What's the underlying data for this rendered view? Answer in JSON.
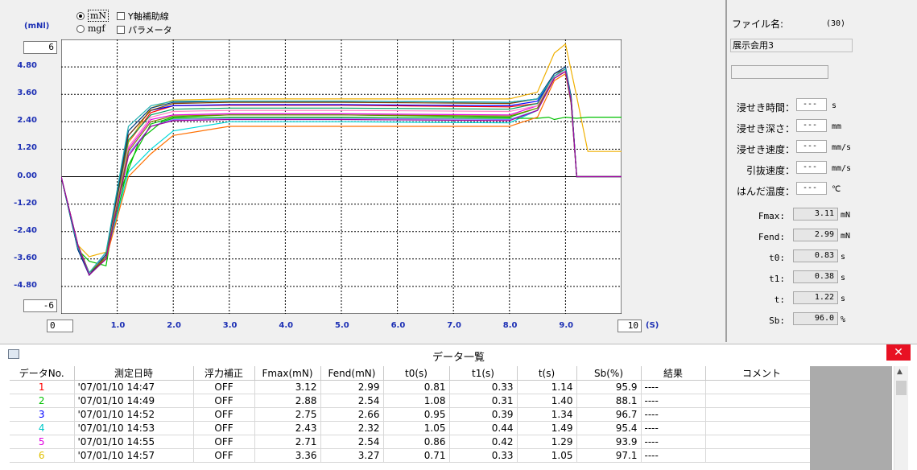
{
  "chart": {
    "unit_label": "(mNl)",
    "y_top_input": "6",
    "y_bottom_input": "-6",
    "x_left_input": "0",
    "x_right_input": "10",
    "x_unit": "(S)",
    "y_ticks": [
      "4.80",
      "3.60",
      "2.40",
      "1.20",
      "0.00",
      "-1.20",
      "-2.40",
      "-3.60",
      "-4.80"
    ],
    "x_ticks": [
      "1.0",
      "2.0",
      "3.0",
      "4.0",
      "5.0",
      "6.0",
      "7.0",
      "8.0",
      "9.0"
    ],
    "options": {
      "mN_label": "mN",
      "mgf_label": "mgf",
      "y_aux_label": "Y軸補助線",
      "param_label": "パラメータ",
      "mN_selected": true
    }
  },
  "chart_data": {
    "type": "line",
    "xlabel": "(S)",
    "ylabel": "(mNl)",
    "xlim": [
      0,
      10
    ],
    "ylim": [
      -6,
      6
    ],
    "grid": true,
    "series": [
      {
        "color": "#ff0000",
        "x": [
          0,
          0.3,
          0.5,
          0.8,
          1.2,
          1.6,
          2.0,
          3.0,
          5.0,
          8.0,
          8.5,
          8.8,
          9.0,
          9.1,
          9.2,
          10
        ],
        "y": [
          0,
          -3.0,
          -4.3,
          -3.5,
          1.5,
          2.8,
          3.1,
          3.12,
          3.12,
          3.05,
          3.2,
          4.3,
          4.6,
          3.5,
          0,
          0
        ]
      },
      {
        "color": "#00c000",
        "x": [
          0,
          0.3,
          0.5,
          0.8,
          1.2,
          1.6,
          2.0,
          3.0,
          5.0,
          8.0,
          8.5,
          8.8,
          9.0,
          9.1,
          9.2,
          10
        ],
        "y": [
          0,
          -3.0,
          -4.3,
          -3.6,
          0.5,
          2.3,
          2.6,
          2.7,
          2.7,
          2.6,
          3.0,
          4.4,
          4.7,
          3.2,
          0,
          0
        ]
      },
      {
        "color": "#0000ff",
        "x": [
          0,
          0.3,
          0.5,
          0.8,
          1.2,
          1.6,
          2.0,
          3.0,
          5.0,
          8.0,
          8.5,
          8.8,
          9.0,
          9.1,
          9.2,
          10
        ],
        "y": [
          0,
          -3.2,
          -4.3,
          -3.4,
          1.8,
          2.9,
          3.1,
          3.15,
          3.15,
          3.1,
          3.3,
          4.4,
          4.7,
          3.4,
          0,
          0
        ]
      },
      {
        "color": "#00d8d8",
        "x": [
          0,
          0.3,
          0.5,
          0.8,
          1.2,
          1.6,
          2.0,
          3.0,
          5.0,
          8.0,
          8.5,
          8.8,
          9.0,
          9.1,
          9.2,
          10
        ],
        "y": [
          0,
          -3.0,
          -4.2,
          -3.5,
          0.2,
          1.2,
          2.0,
          2.4,
          2.4,
          2.35,
          2.9,
          4.3,
          4.6,
          3.2,
          0,
          0
        ]
      },
      {
        "color": "#e000e0",
        "x": [
          0,
          0.3,
          0.5,
          0.8,
          1.2,
          1.6,
          2.0,
          3.0,
          5.0,
          8.0,
          8.5,
          8.8,
          9.0,
          9.1,
          9.2,
          10
        ],
        "y": [
          0,
          -3.0,
          -4.3,
          -3.5,
          1.2,
          2.5,
          2.7,
          2.75,
          2.75,
          2.7,
          3.1,
          4.4,
          4.7,
          3.3,
          0,
          0
        ]
      },
      {
        "color": "#f0b000",
        "x": [
          0,
          0.3,
          0.5,
          0.8,
          1.2,
          1.6,
          2.0,
          3.0,
          5.0,
          8.0,
          8.5,
          8.8,
          9.0,
          9.2,
          9.4,
          10
        ],
        "y": [
          0,
          -3.0,
          -3.5,
          -3.3,
          1.5,
          3.0,
          3.35,
          3.4,
          3.4,
          3.4,
          3.7,
          5.4,
          5.8,
          3.5,
          1.1,
          1.1
        ]
      },
      {
        "color": "#00c000",
        "x": [
          0,
          0.3,
          0.5,
          0.8,
          1.0,
          1.4,
          1.8,
          2.0,
          3.0,
          5.0,
          8.0,
          8.5,
          8.7,
          8.8,
          9.0,
          9.2,
          9.4,
          10
        ],
        "y": [
          0,
          -3.2,
          -3.7,
          -3.9,
          -1.0,
          1.6,
          2.4,
          2.55,
          2.6,
          2.6,
          2.55,
          2.55,
          2.6,
          2.5,
          2.6,
          2.55,
          2.6,
          2.6
        ]
      },
      {
        "color": "#ff7000",
        "x": [
          0,
          0.3,
          0.5,
          0.8,
          1.2,
          1.6,
          2.0,
          3.0,
          5.0,
          8.0,
          8.5,
          8.8,
          9.0,
          9.1,
          9.2,
          10
        ],
        "y": [
          0,
          -3.0,
          -4.2,
          -3.6,
          0.0,
          1.0,
          1.8,
          2.2,
          2.2,
          2.2,
          2.6,
          4.2,
          4.5,
          3.2,
          0,
          0
        ]
      },
      {
        "color": "#00a060",
        "x": [
          0,
          0.3,
          0.5,
          0.8,
          1.2,
          1.6,
          2.0,
          3.0,
          5.0,
          8.0,
          8.5,
          8.8,
          9.0,
          9.1,
          9.2,
          10
        ],
        "y": [
          0,
          -3.1,
          -4.3,
          -3.5,
          1.6,
          2.7,
          2.95,
          3.0,
          3.0,
          2.95,
          3.2,
          4.4,
          4.7,
          3.4,
          0,
          0
        ]
      },
      {
        "color": "#8080ff",
        "x": [
          0,
          0.3,
          0.5,
          0.8,
          1.2,
          1.6,
          2.0,
          3.0,
          5.0,
          8.0,
          8.5,
          8.8,
          9.0,
          9.1,
          9.2,
          10
        ],
        "y": [
          0,
          -3.0,
          -4.2,
          -3.4,
          1.0,
          2.2,
          2.5,
          2.55,
          2.55,
          2.5,
          2.9,
          4.3,
          4.6,
          3.2,
          0,
          0
        ]
      },
      {
        "color": "#804000",
        "x": [
          0,
          0.3,
          0.5,
          0.8,
          1.2,
          1.6,
          2.0,
          3.0,
          5.0,
          8.0,
          8.5,
          8.8,
          9.0,
          9.1,
          9.2,
          10
        ],
        "y": [
          0,
          -3.1,
          -4.3,
          -3.5,
          1.8,
          2.9,
          3.2,
          3.25,
          3.25,
          3.2,
          3.4,
          4.5,
          4.7,
          3.4,
          0,
          0
        ]
      },
      {
        "color": "#ff80c0",
        "x": [
          0,
          0.3,
          0.5,
          0.8,
          1.2,
          1.6,
          2.0,
          3.0,
          5.0,
          8.0,
          8.5,
          8.8,
          9.0,
          9.1,
          9.2,
          10
        ],
        "y": [
          0,
          -3.0,
          -4.2,
          -3.5,
          1.3,
          2.6,
          2.85,
          2.9,
          2.9,
          2.85,
          3.1,
          4.4,
          4.6,
          3.3,
          0,
          0
        ]
      },
      {
        "color": "#004080",
        "x": [
          0,
          0.3,
          0.5,
          0.8,
          1.2,
          1.6,
          2.0,
          3.0,
          5.0,
          8.0,
          8.5,
          8.8,
          9.0,
          9.1,
          9.2,
          10
        ],
        "y": [
          0,
          -3.2,
          -4.3,
          -3.4,
          2.0,
          3.0,
          3.25,
          3.3,
          3.3,
          3.25,
          3.4,
          4.5,
          4.8,
          3.5,
          0,
          0
        ]
      },
      {
        "color": "#808000",
        "x": [
          0,
          0.3,
          0.5,
          0.8,
          1.2,
          1.6,
          2.0,
          3.0,
          5.0,
          8.0,
          8.5,
          8.8,
          9.0,
          9.1,
          9.2,
          10
        ],
        "y": [
          0,
          -3.0,
          -4.2,
          -3.5,
          1.1,
          2.4,
          2.65,
          2.7,
          2.7,
          2.65,
          3.0,
          4.3,
          4.6,
          3.2,
          0,
          0
        ]
      },
      {
        "color": "#20b0b0",
        "x": [
          0,
          0.3,
          0.5,
          0.8,
          1.2,
          1.6,
          2.0,
          3.0,
          5.0,
          8.0,
          8.5,
          8.8,
          9.0,
          9.1,
          9.2,
          10
        ],
        "y": [
          0,
          -3.1,
          -4.2,
          -3.3,
          2.2,
          3.1,
          3.3,
          3.3,
          3.3,
          3.25,
          3.4,
          4.4,
          4.7,
          3.4,
          0,
          0
        ]
      },
      {
        "color": "#a000a0",
        "x": [
          0,
          0.3,
          0.5,
          0.8,
          1.2,
          1.6,
          2.0,
          3.0,
          5.0,
          8.0,
          8.5,
          8.8,
          9.0,
          9.1,
          9.2,
          10
        ],
        "y": [
          0,
          -3.0,
          -4.3,
          -3.6,
          0.9,
          2.2,
          2.45,
          2.5,
          2.5,
          2.45,
          2.9,
          4.3,
          4.6,
          3.3,
          0,
          0
        ]
      }
    ]
  },
  "info": {
    "filename_label": "ファイル名:",
    "filename_num": "(30)",
    "filename_value": "展示会用3",
    "dip_time_label": "浸せき時間：",
    "dip_depth_label": "浸せき深さ：",
    "dip_speed_label": "浸せき速度：",
    "pull_speed_label": "引抜速度：",
    "solder_temp_label": "はんだ温度：",
    "dash": "---",
    "unit_s": "s",
    "unit_mm": "mm",
    "unit_mms": "mm/s",
    "unit_c": "℃",
    "fmax_label": "Fmax:",
    "fmax_value": "3.11",
    "fend_label": "Fend:",
    "fend_value": "2.99",
    "unit_mN": "mN",
    "t0_label": "t0:",
    "t0_value": "0.83",
    "t1_label": "t1:",
    "t1_value": "0.38",
    "t_label": "t:",
    "t_value": "1.22",
    "sb_label": "Sb:",
    "sb_value": "96.0",
    "unit_pct": "%"
  },
  "list": {
    "title": "データ一覧",
    "headers": [
      "データNo.",
      "測定日時",
      "浮力補正",
      "Fmax(mN)",
      "Fend(mN)",
      "t0(s)",
      "t1(s)",
      "t(s)",
      "Sb(%)",
      "結果",
      "コメント"
    ],
    "rows": [
      {
        "no": "1",
        "color": "#ff0000",
        "date": "'07/01/10 14:47",
        "comp": "OFF",
        "fmax": "3.12",
        "fend": "2.99",
        "t0": "0.81",
        "t1": "0.33",
        "t": "1.14",
        "sb": "95.9",
        "result": "----"
      },
      {
        "no": "2",
        "color": "#00c000",
        "date": "'07/01/10 14:49",
        "comp": "OFF",
        "fmax": "2.88",
        "fend": "2.54",
        "t0": "1.08",
        "t1": "0.31",
        "t": "1.40",
        "sb": "88.1",
        "result": "----"
      },
      {
        "no": "3",
        "color": "#0000ff",
        "date": "'07/01/10 14:52",
        "comp": "OFF",
        "fmax": "2.75",
        "fend": "2.66",
        "t0": "0.95",
        "t1": "0.39",
        "t": "1.34",
        "sb": "96.7",
        "result": "----"
      },
      {
        "no": "4",
        "color": "#00c8c8",
        "date": "'07/01/10 14:53",
        "comp": "OFF",
        "fmax": "2.43",
        "fend": "2.32",
        "t0": "1.05",
        "t1": "0.44",
        "t": "1.49",
        "sb": "95.4",
        "result": "----"
      },
      {
        "no": "5",
        "color": "#e000e0",
        "date": "'07/01/10 14:55",
        "comp": "OFF",
        "fmax": "2.71",
        "fend": "2.54",
        "t0": "0.86",
        "t1": "0.42",
        "t": "1.29",
        "sb": "93.9",
        "result": "----"
      },
      {
        "no": "6",
        "color": "#e0c000",
        "date": "'07/01/10 14:57",
        "comp": "OFF",
        "fmax": "3.36",
        "fend": "3.27",
        "t0": "0.71",
        "t1": "0.33",
        "t": "1.05",
        "sb": "97.1",
        "result": "----"
      }
    ]
  }
}
